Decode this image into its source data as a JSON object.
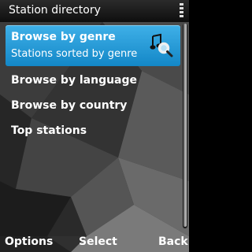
{
  "header": {
    "title": "Station directory"
  },
  "list": {
    "items": [
      {
        "label": "Browse by genre",
        "sublabel": "Stations sorted by genre",
        "icon": "music-search-icon",
        "selected": true
      },
      {
        "label": "Browse by language"
      },
      {
        "label": "Browse by country"
      },
      {
        "label": "Top stations"
      }
    ]
  },
  "softkeys": {
    "left": "Options",
    "center": "Select",
    "right": "Back"
  },
  "colors": {
    "highlight": "#2a9fdb",
    "background": "#3a3a3a",
    "text": "#ffffff"
  }
}
